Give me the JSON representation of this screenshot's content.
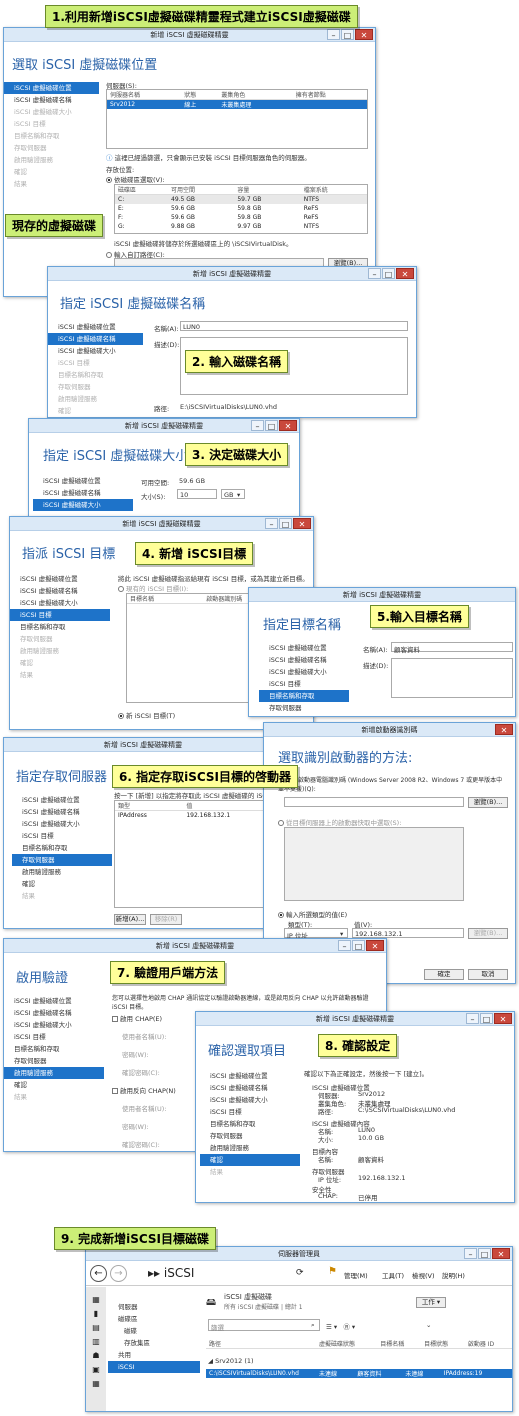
{
  "steps": {
    "s1": "1.利用新增iSCSI虛擬磁碟精靈程式建立iSCSI虛擬磁碟",
    "s_disk": "現存的虛擬磁碟",
    "s2": "2. 輸入磁碟名稱",
    "s3": "3. 決定磁碟大小",
    "s4": "4. 新增 iSCSI目標",
    "s5": "5.輸入目標名稱",
    "s6": "6. 指定存取iSCSI目標的啓動器",
    "s7": "7. 驗證用戶端方法",
    "s8": "8. 確認設定",
    "s9": "9. 完成新增iSCSI目標磁碟"
  },
  "wizard_title": "新增 iSCSI 虛擬磁碟精靈",
  "initiator_title": "新增啟動器識別碼",
  "nav": [
    "iSCSI 虛擬磁碟位置",
    "iSCSI 虛擬磁碟名稱",
    "iSCSI 虛擬磁碟大小",
    "iSCSI 目標",
    "目標名稱和存取",
    "存取伺服器",
    "啟用驗證服務",
    "確認",
    "結果"
  ],
  "w1": {
    "heading": "選取 iSCSI 虛擬磁碟位置",
    "server_label": "伺服器(S):",
    "cols": [
      "伺服器名稱",
      "狀態",
      "叢集角色",
      "擁有者節點"
    ],
    "row": [
      "Srv2012",
      "線上",
      "未叢集處理",
      ""
    ],
    "note": "這裡已經過篩選，只會顯示已安裝 iSCSI 目標伺服器角色的伺服器。",
    "storage": "存放位置:",
    "by_volume": "依磁碟區選取(V):",
    "vcols": [
      "磁碟區",
      "可用空間",
      "容量",
      "檔案系統"
    ],
    "vols": [
      [
        "C:",
        "49.5 GB",
        "59.7 GB",
        "NTFS"
      ],
      [
        "E:",
        "59.6 GB",
        "59.8 GB",
        "ReFS"
      ],
      [
        "F:",
        "59.6 GB",
        "59.8 GB",
        "ReFS"
      ],
      [
        "G:",
        "9.88 GB",
        "9.97 GB",
        "NTFS"
      ]
    ],
    "save_note": "iSCSI 虛擬磁碟將儲存於所選磁碟區上的 \\iSCSIVirtualDisk。",
    "custom": "輸入自訂路徑(C):",
    "browse": "瀏覽(B)..."
  },
  "w2": {
    "heading": "指定 iSCSI 虛擬磁碟名稱",
    "name_label": "名稱(A):",
    "name_value": "LUN0",
    "desc_label": "描述(D):",
    "path_label": "路徑:",
    "path_value": "E:\\iSCSIVirtualDisks\\LUN0.vhd"
  },
  "w3": {
    "heading": "指定 iSCSI 虛擬磁碟大小",
    "free_label": "可用空間:",
    "free_value": "59.6 GB",
    "size_label": "大小(S):",
    "size_value": "10",
    "unit": "GB"
  },
  "w4": {
    "heading": "指派 iSCSI 目標",
    "text": "將此 iSCSI 虛擬磁碟指派給現有 iSCSI 目標，或為其建立新目標。",
    "existing": "現有的 iSCSI 目標(I):",
    "cols": [
      "目標名稱",
      "啟動器識別碼"
    ],
    "new_target": "新 iSCSI 目標(T)"
  },
  "w5": {
    "heading": "指定目標名稱",
    "name_label": "名稱(A):",
    "name_value": "顧客資料",
    "desc_label": "描述(D):"
  },
  "w6": {
    "heading": "指定存取伺服器",
    "text": "按一下 [新增] 以指定將存取此 iSCSI 虛擬磁碟的 iSCSI 啟動器。",
    "cols": [
      "類型",
      "值"
    ],
    "row": [
      "IPAddress",
      "192.168.132.1"
    ],
    "add": "新增(A)...",
    "remove": "移除(R)"
  },
  "w6b": {
    "heading": "選取識別啟動器的方法:",
    "opt1": "查詢啟動器電腦識別碼 (Windows Server 2008 R2、Windows 7 或更早版本中並不支援)(Q):",
    "opt2": "從目標伺服器上的啟動器快取中選取(S):",
    "opt3": "輸入所選類型的值(E)",
    "type_label": "類型(T):",
    "type_value": "IP 位址",
    "value_label": "值(V):",
    "value_value": "192.168.132.1",
    "browse": "瀏覽(B)...",
    "ok": "確定",
    "cancel": "取消"
  },
  "w7": {
    "heading": "啟用驗證",
    "text": "您可以選擇性地啟用 CHAP 通訊協定以驗證啟動器連線，或是啟用反向 CHAP 以允許啟動器驗證 iSCSI 目標。",
    "chap": "啟用 CHAP(E)",
    "user": "使用者名稱(U):",
    "pwd": "密碼(W):",
    "confirm": "確認密碼(C):",
    "rchap": "啟用反向 CHAP(N)"
  },
  "w8": {
    "heading": "確認選取項目",
    "text": "確認以下為正確設定，然後按一下 [建立]。",
    "loc_h": "ISCSI 虛擬磁碟位置",
    "server": "伺服器:",
    "server_v": "Srv2012",
    "cluster": "叢集角色:",
    "cluster_v": "未叢集處理",
    "path": "路徑:",
    "path_v": "C:\\iSCSIVirtualDisks\\LUN0.vhd",
    "prop_h": "ISCSI 虛擬磁碟內容",
    "name": "名稱:",
    "name_v": "LUN0",
    "size": "大小:",
    "size_v": "10.0 GB",
    "tgt_h": "目標內容",
    "tname": "名稱:",
    "tname_v": "顧客資料",
    "acc_h": "存取伺服器",
    "ip": "IP 位址:",
    "ip_v": "192.168.132.1",
    "sec_h": "安全性",
    "chap": "CHAP:",
    "chap_v": "已停用",
    "rchap": "反向 CHAP:",
    "rchap_v": "已停用"
  },
  "sm": {
    "title": "伺服器管理員",
    "crumb": "iSCSI",
    "menus": [
      "管理(M)",
      "工具(T)",
      "檢視(V)",
      "說明(H)"
    ],
    "nav": [
      "伺服器",
      "磁碟區",
      "磁碟",
      "存放集區",
      "共用",
      "iSCSI"
    ],
    "panel_title": "iSCSI 虛擬磁碟",
    "panel_sub": "所有 iSCSI 虛擬磁碟 | 總計 1",
    "tasks": "工作",
    "filter": "篩選",
    "cols": [
      "路徑",
      "虛擬磁碟狀態",
      "目標名稱",
      "目標狀態",
      "啟動器 ID"
    ],
    "group": "Srv2012 (1)",
    "row": [
      "C:\\iSCSIVirtualDisks\\LUN0.vhd",
      "未連線",
      "顧客資料",
      "未連線",
      "IPAddress:19"
    ]
  }
}
